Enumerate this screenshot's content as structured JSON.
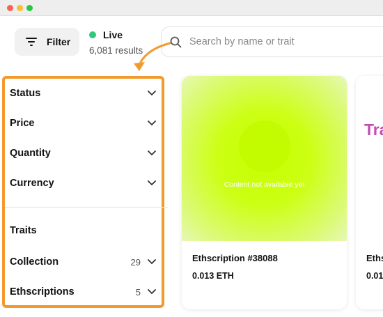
{
  "filter_button": {
    "label": "Filter",
    "icon": "filter-lines-icon"
  },
  "status": {
    "live_label": "Live",
    "results": "6,081 results",
    "live_color": "#34c77b"
  },
  "search": {
    "placeholder": "Search by name or trait",
    "icon": "search-icon"
  },
  "highlight_color": "#f29a2e",
  "sidebar": {
    "facets": [
      {
        "label": "Status",
        "count": ""
      },
      {
        "label": "Price",
        "count": ""
      },
      {
        "label": "Quantity",
        "count": ""
      },
      {
        "label": "Currency",
        "count": ""
      }
    ],
    "traits_label": "Traits",
    "collection": {
      "label": "Collection",
      "count": "29"
    },
    "ethscriptions": {
      "label": "Ethscriptions",
      "count": "5"
    }
  },
  "cards": [
    {
      "media_text": "Content not available yet",
      "title": "Ethscription #38088",
      "price": "0.013 ETH",
      "media_color": "#c6ff00"
    },
    {
      "banner_text": "Tra",
      "title": "Eths",
      "price": "0.01",
      "banner_color": "#c24cb3"
    }
  ]
}
